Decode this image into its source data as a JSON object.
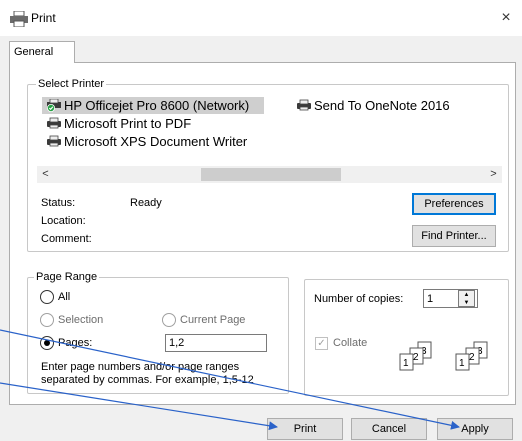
{
  "window": {
    "title": "Print",
    "close_glyph": "×",
    "icon": "printer-icon"
  },
  "tabs": [
    {
      "label": "General"
    }
  ],
  "select_printer": {
    "group_label": "Select Printer",
    "printers": [
      {
        "name": "HP Officejet Pro 8600 (Network)",
        "icon": "printer-default-icon",
        "selected": true
      },
      {
        "name": "Send To OneNote 2016",
        "icon": "printer-icon",
        "selected": false
      },
      {
        "name": "Microsoft Print to PDF",
        "icon": "printer-icon",
        "selected": false
      },
      {
        "name": "Microsoft XPS Document Writer",
        "icon": "printer-icon",
        "selected": false
      }
    ],
    "scroll_left": "<",
    "scroll_right": ">",
    "status_label": "Status:",
    "status_value": "Ready",
    "location_label": "Location:",
    "comment_label": "Comment:",
    "preferences_button": "Preferences",
    "find_printer_button": "Find Printer..."
  },
  "page_range": {
    "group_label": "Page Range",
    "all_label": "All",
    "selection_label": "Selection",
    "current_page_label": "Current Page",
    "pages_label": "Pages:",
    "pages_value": "1,2",
    "help_line1": "Enter page numbers and/or page ranges",
    "help_line2": "separated by commas.  For example, 1,5-12",
    "selected_option": "pages"
  },
  "copies": {
    "number_label": "Number of copies:",
    "number_value": "1",
    "collate_label": "Collate",
    "collate_checked": true,
    "collate_icon": "collate-pages-icon"
  },
  "buttons": {
    "print": "Print",
    "cancel": "Cancel",
    "apply": "Apply"
  },
  "colors": {
    "arrow": "#2a62c9",
    "focus": "#0078d7",
    "selection": "#cfcfcf"
  }
}
